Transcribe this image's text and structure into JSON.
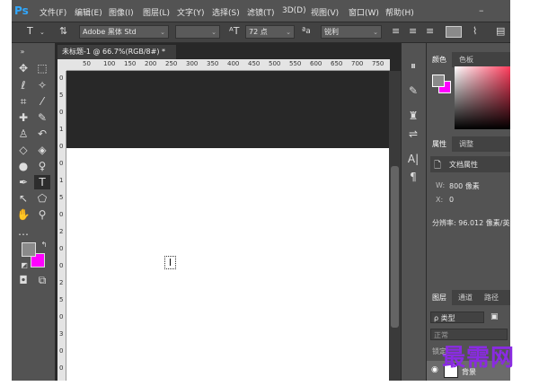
{
  "app": {
    "logo": "Ps"
  },
  "menu": [
    "文件(F)",
    "编辑(E)",
    "图像(I)",
    "图层(L)",
    "文字(Y)",
    "选择(S)",
    "滤镜(T)",
    "3D(D)",
    "视图(V)",
    "窗口(W)",
    "帮助(H)"
  ],
  "options": {
    "tool_glyph": "T",
    "font_family": "Adobe 黑体 Std",
    "font_style": "",
    "font_size": "72 点",
    "aa_label": "ªa",
    "anti_alias": "锐利"
  },
  "document": {
    "tab_title": "未标题-1 @ 66.7%(RGB/8#) *",
    "tab_close": "×",
    "ruler_h": [
      "50",
      "100",
      "150",
      "200",
      "250",
      "300",
      "350",
      "400",
      "450",
      "500",
      "550",
      "600",
      "650",
      "700",
      "750"
    ],
    "ruler_v": [
      "0",
      "5",
      "0",
      "1",
      "0",
      "0",
      "1",
      "5",
      "0",
      "2",
      "0",
      "0",
      "2",
      "5",
      "0",
      "3",
      "0",
      "0"
    ]
  },
  "panels": {
    "color_tabs": [
      "颜色",
      "色板"
    ],
    "props_tabs": [
      "属性",
      "调整"
    ],
    "doc_props_title": "文档属性",
    "width_label": "W:",
    "width_value": "800 像素",
    "x_label": "X:",
    "x_value": "0",
    "resolution": "分辨率: 96.012 像素/英",
    "layers_tabs": [
      "图层",
      "通道",
      "路径"
    ],
    "layers_search": "ρ 类型",
    "blend_mode": "正常",
    "lock_label": "锁定:",
    "layer_name": "背景"
  },
  "watermark": "最需网",
  "colors": {
    "foreground": "#8a8a8a",
    "background": "#ff00ff",
    "accent": "#31a8ff"
  }
}
